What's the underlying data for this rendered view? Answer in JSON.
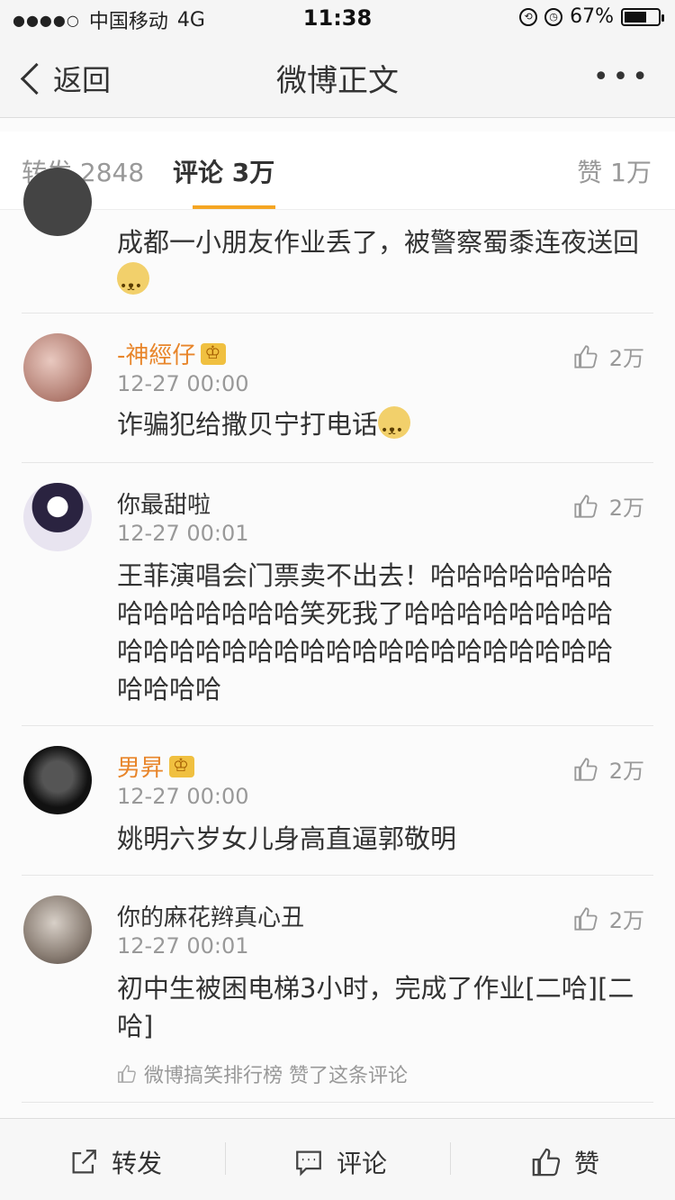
{
  "status_bar": {
    "carrier": "中国移动",
    "network": "4G",
    "time": "11:38",
    "battery": "67%",
    "battery_level": 0.67
  },
  "nav": {
    "back_label": "返回",
    "title": "微博正文",
    "more": "•••"
  },
  "tabs": {
    "repost": "转发 2848",
    "comment": "评论 3万",
    "like": "赞 1万"
  },
  "comments": [
    {
      "text": "成都一小朋友作业丢了，被警察蜀黍连夜送回"
    },
    {
      "name": "-神經仔",
      "vip": true,
      "time": "12-27 00:00",
      "likes": "2万",
      "text": "诈骗犯给撒贝宁打电话"
    },
    {
      "name": "你最甜啦",
      "vip": false,
      "time": "12-27 00:01",
      "likes": "2万",
      "text": "王菲演唱会门票卖不出去！哈哈哈哈哈哈哈哈哈哈哈哈哈哈笑死我了哈哈哈哈哈哈哈哈哈哈哈哈哈哈哈哈哈哈哈哈哈哈哈哈哈哈哈哈哈哈哈"
    },
    {
      "name": "男昇",
      "vip": true,
      "time": "12-27 00:00",
      "likes": "2万",
      "text": "姚明六岁女儿身高直逼郭敬明"
    },
    {
      "name": "你的麻花辫真心丑",
      "vip": false,
      "time": "12-27 00:01",
      "likes": "2万",
      "text": "初中生被困电梯3小时，完成了作业[二哈][二哈]",
      "liked_by": "微博搞笑排行榜 赞了这条评论"
    }
  ],
  "bottom_bar": {
    "repost": "转发",
    "comment": "评论",
    "like": "赞"
  },
  "colors": {
    "accent": "#f5a623",
    "vip_name": "#e8852a"
  }
}
